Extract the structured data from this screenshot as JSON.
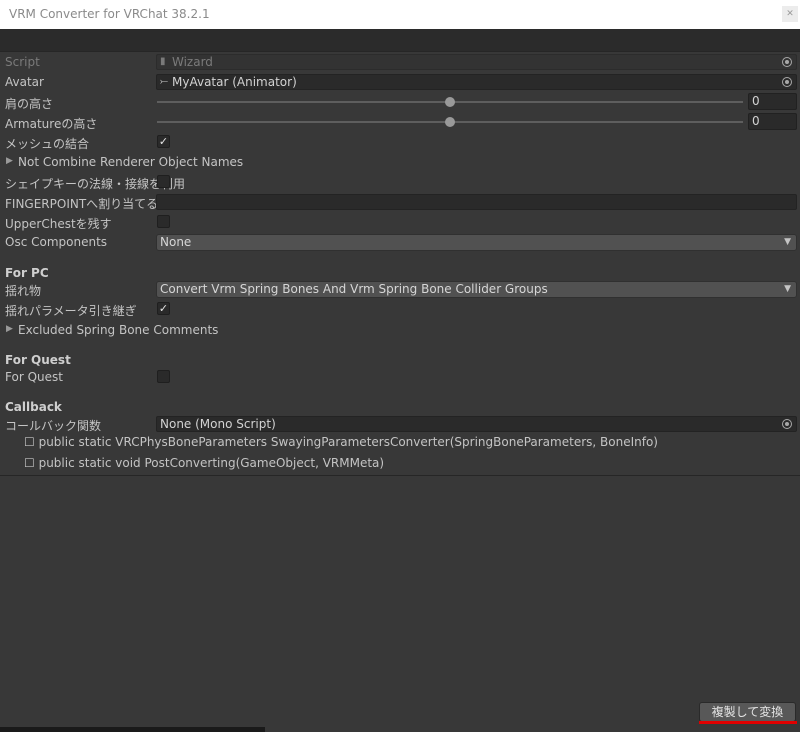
{
  "window": {
    "title": "VRM Converter for VRChat 38.2.1"
  },
  "fields": {
    "script": {
      "label": "Script",
      "value": "Wizard",
      "icon": "script-file-icon"
    },
    "avatar": {
      "label": "Avatar",
      "value": "MyAvatar (Animator)",
      "icon": "animator-icon"
    },
    "shoulder_height": {
      "label": "肩の高さ",
      "value": "0",
      "slider_fraction": 0.5
    },
    "armature_height": {
      "label": "Armatureの高さ",
      "value": "0",
      "slider_fraction": 0.5
    },
    "combine_meshes": {
      "label": "メッシュの結合",
      "checked": true
    },
    "not_combine": {
      "label": "Not Combine Renderer Object Names"
    },
    "blendshape_normals": {
      "label": "シェイプキーの法線・接線を利用",
      "checked": false
    },
    "fingerpoint": {
      "label": "FINGERPOINTへ割り当てる表",
      "value": ""
    },
    "upperchest": {
      "label": "UpperChestを残す",
      "checked": false
    },
    "osc": {
      "label": "Osc Components",
      "value": "None"
    }
  },
  "for_pc": {
    "header": "For PC",
    "swaying": {
      "label": "揺れ物",
      "value": "Convert Vrm Spring Bones And Vrm Spring Bone Collider Groups"
    },
    "take_over": {
      "label": "揺れパラメータ引き継ぎ",
      "checked": true
    },
    "excluded": {
      "label": "Excluded Spring Bone Comments"
    }
  },
  "for_quest": {
    "header": "For Quest",
    "toggle": {
      "label": "For Quest",
      "checked": false
    }
  },
  "callback": {
    "header": "Callback",
    "field": {
      "label": "コールバック関数",
      "value": "None (Mono Script)"
    },
    "lines": [
      "☐ public static VRCPhysBoneParameters SwayingParametersConverter(SpringBoneParameters, BoneInfo)",
      "☐ public static void PostConverting(GameObject, VRMMeta)"
    ]
  },
  "actions": {
    "convert": "複製して変換"
  },
  "icons": {
    "close": "close-icon",
    "foldout": "foldout-arrow-icon",
    "dropdown": "dropdown-arrow-icon"
  },
  "colors": {
    "background": "#383838",
    "field": "#2a2a2a",
    "highlight": "#e00000"
  }
}
